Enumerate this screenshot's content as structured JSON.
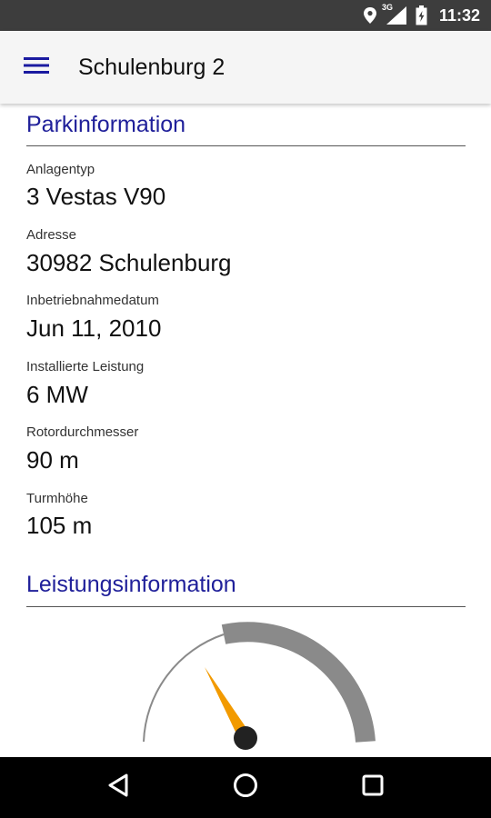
{
  "status_bar": {
    "time": "11:32",
    "network": "3G",
    "icons": [
      "location-icon",
      "signal-icon",
      "battery-icon"
    ]
  },
  "app_bar": {
    "menu_icon": "hamburger-menu-icon",
    "title": "Schulenburg 2"
  },
  "park_info": {
    "title": "Parkinformation",
    "fields": [
      {
        "label": "Anlagentyp",
        "value": "3 Vestas V90"
      },
      {
        "label": "Adresse",
        "value": "30982 Schulenburg"
      },
      {
        "label": "Inbetriebnahmedatum",
        "value": "Jun 11, 2010"
      },
      {
        "label": "Installierte Leistung",
        "value": "6 MW"
      },
      {
        "label": "Rotordurchmesser",
        "value": "90 m"
      },
      {
        "label": "Turmhöhe",
        "value": "105 m"
      }
    ]
  },
  "power_info": {
    "title": "Leistungsinformation",
    "gauge": {
      "needle_fraction": 0.27
    }
  },
  "nav_bar": {
    "icons": [
      "back-icon",
      "home-icon",
      "recents-icon"
    ]
  },
  "colors": {
    "section_title": "#20209a",
    "menu_icon": "#1a1aa0",
    "gauge_arc": "#8a8a8a",
    "gauge_needle": "#f29a00",
    "status_bar": "#3d3d3d",
    "nav_bar": "#000000"
  }
}
